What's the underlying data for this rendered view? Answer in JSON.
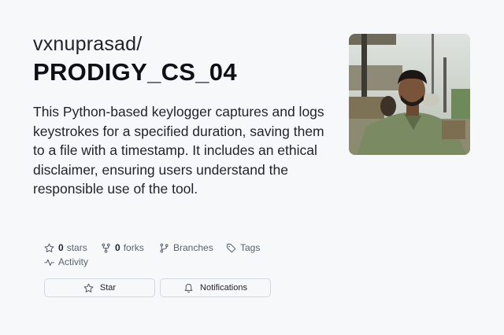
{
  "repo": {
    "owner": "vxnuprasad/",
    "name": "PRODIGY_CS_04",
    "description": "This Python-based keylogger captures and logs keystrokes for a specified duration, saving them to a file with a timestamp. It includes an ethical disclaimer, ensuring users understand the responsible use of the tool."
  },
  "stats": {
    "stars_count": "0",
    "stars_label": "stars",
    "forks_count": "0",
    "forks_label": "forks",
    "branches_label": "Branches",
    "tags_label": "Tags",
    "activity_label": "Activity"
  },
  "buttons": {
    "star_label": "Star",
    "notifications_label": "Notifications"
  },
  "icons": {
    "star": "star-icon",
    "fork": "fork-icon",
    "branch": "branch-icon",
    "tag": "tag-icon",
    "activity": "pulse-icon",
    "bell": "bell-icon"
  },
  "colors": {
    "background": "#f6f8fa",
    "text": "#1f2328",
    "muted": "#59636e",
    "border": "#d1d9e0"
  }
}
